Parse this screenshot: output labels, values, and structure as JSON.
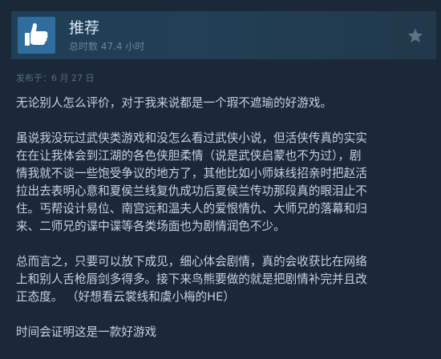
{
  "review": {
    "recommendation": "推荐",
    "playtime": "总时数 47.4 小时",
    "posted": "发布于：6 月 27 日",
    "paragraphs": [
      [
        "无论别人怎么评价，对于我来说都是一个瑕不遮瑜的好游戏。"
      ],
      [
        "虽说我没玩过武侠类游戏和没怎么看过武侠小说，但活侠传真的实实",
        "在在让我体会到江湖的各色侠胆柔情（说是武侠启蒙也不为过），剧",
        "情我就不谈一些饱受争议的地方了，其他比如小师妹线招亲时把赵活",
        "拉出去表明心意和夏侯兰线复仇成功后夏侯兰传功那段真的眼泪止不",
        "住。丐帮设计易位、南宫远和温夫人的爱恨情仇、大师兄的落幕和归",
        "来、二师兄的谍中谍等各类场面也为剧情润色不少。"
      ],
      [
        "总而言之，只要可以放下成见，细心体会剧情，真的会收获比在网络",
        "上和别人舌枪唇剑多得多。接下来鸟熊要做的就是把剧情补完并且改",
        "正态度。  （好想看云裳线和虞小梅的HE）"
      ],
      [
        "时间会证明这是一款好游戏"
      ]
    ]
  },
  "icons": {
    "thumb": "thumbs-up-icon",
    "award": "star-icon"
  },
  "colors": {
    "background": "#1b2838",
    "header": "#213f55",
    "thumb_box": "#2e6d9e",
    "text": "#c6d4df",
    "muted": "#6c8197"
  }
}
